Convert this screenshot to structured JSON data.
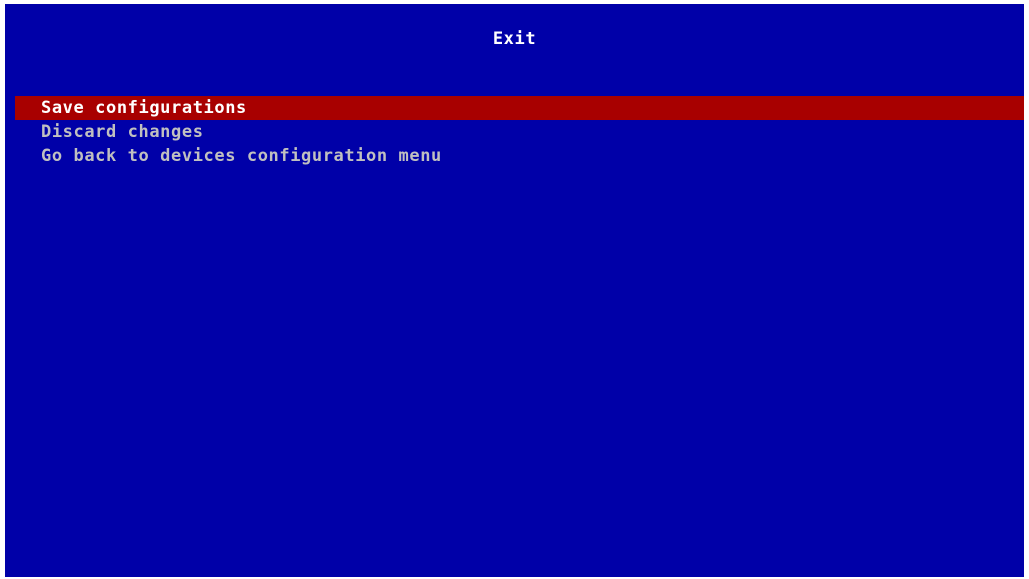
{
  "title": "Exit",
  "menu": {
    "items": [
      {
        "label": "Save configurations",
        "selected": true
      },
      {
        "label": "Discard changes",
        "selected": false
      },
      {
        "label": "Go back to devices configuration menu",
        "selected": false
      }
    ]
  },
  "colors": {
    "background": "#0000a8",
    "highlight": "#a80000",
    "title_text": "#ffffff",
    "selected_text": "#ffffff",
    "normal_text": "#c0c0c0"
  }
}
